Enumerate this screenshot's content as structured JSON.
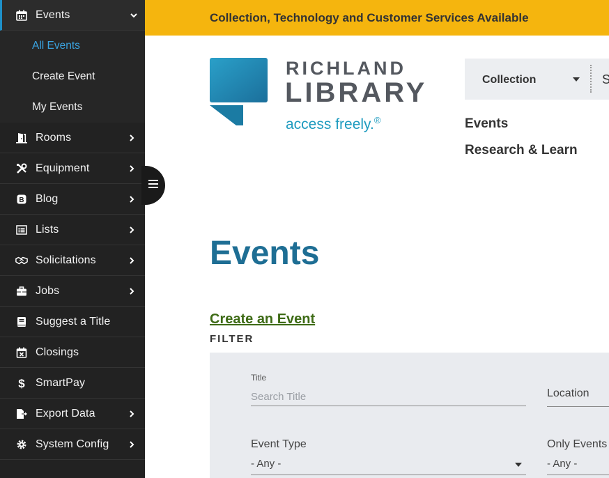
{
  "sidebar": {
    "items": [
      {
        "label": "Events",
        "icon": "calendar-icon",
        "expanded": true
      },
      {
        "label": "Rooms",
        "icon": "door-icon"
      },
      {
        "label": "Equipment",
        "icon": "tools-icon"
      },
      {
        "label": "Blog",
        "icon": "blog-icon"
      },
      {
        "label": "Lists",
        "icon": "list-icon"
      },
      {
        "label": "Solicitations",
        "icon": "handshake-icon"
      },
      {
        "label": "Jobs",
        "icon": "briefcase-icon"
      },
      {
        "label": "Suggest a Title",
        "icon": "book-icon"
      },
      {
        "label": "Closings",
        "icon": "calendar-x-icon"
      },
      {
        "label": "SmartPay",
        "icon": "dollar-icon"
      },
      {
        "label": "Export Data",
        "icon": "export-icon"
      },
      {
        "label": "System Config",
        "icon": "gear-icon"
      }
    ],
    "events_sub": [
      "All Events",
      "Create Event",
      "My Events"
    ],
    "accent": "#1e90c8"
  },
  "banner": {
    "text": "Collection, Technology and Customer Services Available",
    "color": "#f5b50e"
  },
  "logo": {
    "line1": "RICHLAND",
    "line2": "LIBRARY",
    "tagline": "access freely.",
    "mark": "®"
  },
  "header": {
    "collection_select": "Collection",
    "next_partial": "S",
    "nav": [
      "Events",
      "Research & Learn"
    ]
  },
  "main": {
    "title": "Events",
    "create_link": "Create an Event",
    "filter_heading": "FILTER"
  },
  "filter": {
    "title_label": "Title",
    "title_placeholder": "Search Title",
    "location_label": "Location",
    "event_type_label": "Event Type",
    "event_type_value": "- Any -",
    "only_events_label": "Only Events",
    "only_events_value": "- Any -"
  }
}
